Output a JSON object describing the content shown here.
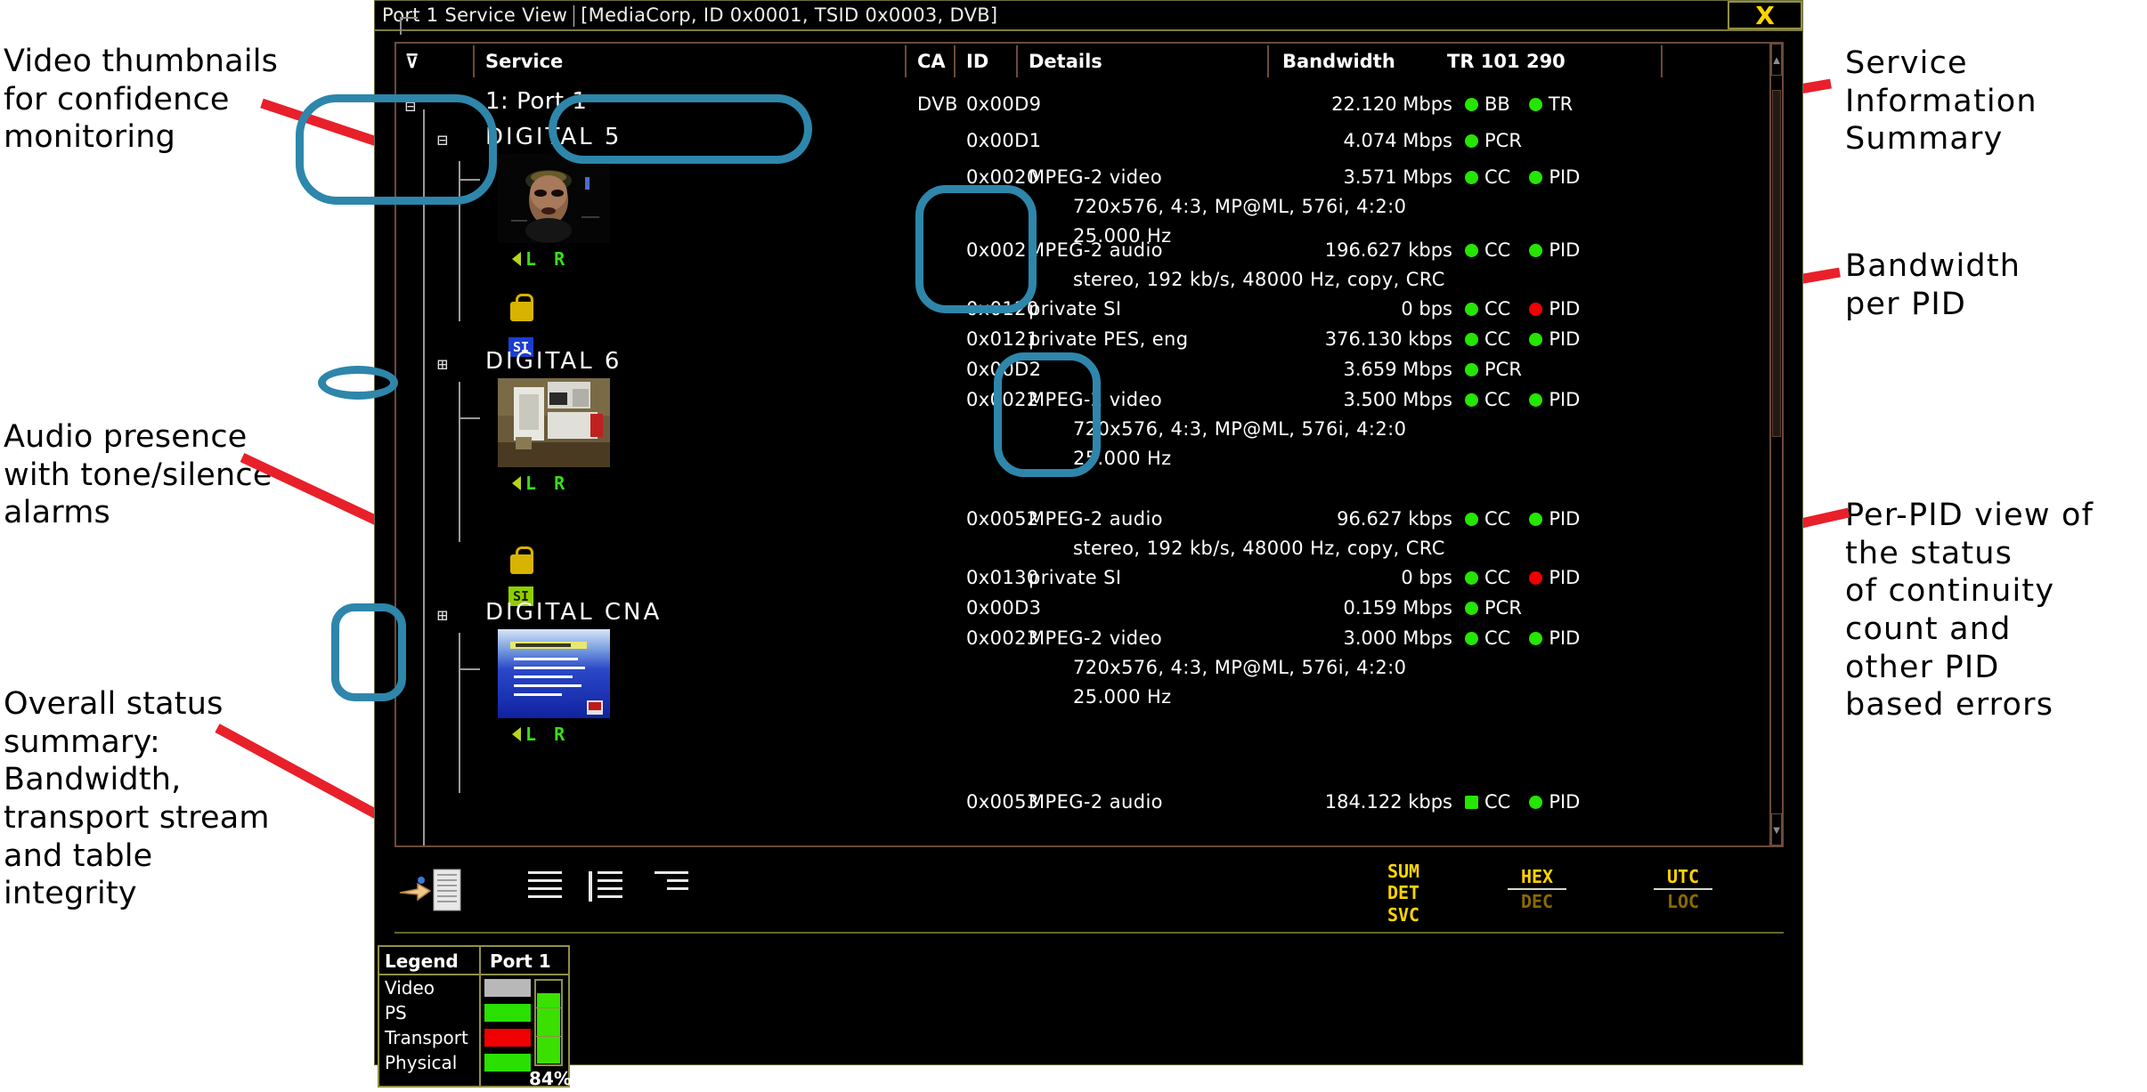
{
  "annotations": [
    {
      "id": "a1",
      "text": "Video thumbnails\nfor confidence\nmonitoring"
    },
    {
      "id": "a2",
      "text": "Audio presence\nwith tone/silence\nalarms"
    },
    {
      "id": "a3",
      "text": "Overall status\nsummary:\nBandwidth,\ntransport stream\nand table\nintegrity"
    },
    {
      "id": "a4",
      "text": "Service\nInformation\nSummary"
    },
    {
      "id": "a5",
      "text": "Bandwidth\nper PID"
    },
    {
      "id": "a6",
      "text": "Per-PID view of\nthe status\nof continuity\ncount and\nother PID\nbased errors"
    }
  ],
  "window": {
    "title": "Port 1 Service View",
    "subtitle": "[MediaCorp, ID 0x0001, TSID 0x0003, DVB]",
    "close_label": "X"
  },
  "table": {
    "headers": {
      "service": "Service",
      "ca": "CA",
      "id": "ID",
      "details": "Details",
      "bandwidth": "Bandwidth",
      "tr": "TR 101 290"
    },
    "root": {
      "service": "1: Port 1",
      "ca": "DVB",
      "id": "0x00D9",
      "bandwidth": "22.120 Mbps",
      "flag1": "BB",
      "flag2": "TR"
    },
    "root_child": {
      "id": "0x00D1",
      "bandwidth": "4.074 Mbps",
      "flag1": "PCR"
    },
    "services": [
      {
        "name": "DIGITAL 5",
        "audio": "L R",
        "rows": [
          {
            "id": "0x0020",
            "detail": "MPEG-2 video",
            "sub": [
              "720x576, 4:3, MP@ML, 576i, 4:2:0",
              "25.000 Hz"
            ],
            "bandwidth": "3.571 Mbps",
            "flags": [
              {
                "label": "CC",
                "color": "green"
              },
              {
                "label": "PID",
                "color": "green"
              }
            ]
          }
        ]
      },
      {
        "name": "DIGITAL 6",
        "audio": "L R",
        "rows": [
          {
            "id": "0x0021",
            "detail": "MPEG-2 audio",
            "sub": [
              "stereo, 192 kb/s, 48000 Hz, copy, CRC"
            ],
            "bandwidth": "196.627 kbps",
            "flags": [
              {
                "label": "CC",
                "color": "green"
              },
              {
                "label": "PID",
                "color": "green"
              }
            ]
          },
          {
            "id": "0x0120",
            "detail": "private SI",
            "sub": [],
            "bandwidth": "0 bps",
            "flags": [
              {
                "label": "CC",
                "color": "green"
              },
              {
                "label": "PID",
                "color": "red"
              }
            ]
          },
          {
            "id": "0x0121",
            "detail": "private PES, eng",
            "sub": [],
            "bandwidth": "376.130 kbps",
            "flags": [
              {
                "label": "CC",
                "color": "green"
              },
              {
                "label": "PID",
                "color": "green"
              }
            ]
          },
          {
            "id": "0x00D2",
            "detail": "",
            "sub": [],
            "bandwidth": "3.659 Mbps",
            "flags": [
              {
                "label": "PCR",
                "color": "green"
              }
            ]
          },
          {
            "id": "0x0022",
            "detail": "MPEG-2 video",
            "sub": [
              "720x576, 4:3, MP@ML, 576i, 4:2:0",
              "25.000 Hz"
            ],
            "bandwidth": "3.500 Mbps",
            "flags": [
              {
                "label": "CC",
                "color": "green"
              },
              {
                "label": "PID",
                "color": "green"
              }
            ]
          }
        ]
      },
      {
        "name": "DIGITAL CNA",
        "audio": "L R",
        "rows": [
          {
            "id": "0x0052",
            "detail": "MPEG-2 audio",
            "sub": [
              "stereo, 192 kb/s, 48000 Hz, copy, CRC"
            ],
            "bandwidth": "96.627 kbps",
            "flags": [
              {
                "label": "CC",
                "color": "green"
              },
              {
                "label": "PID",
                "color": "green"
              }
            ]
          },
          {
            "id": "0x0130",
            "detail": "private SI",
            "sub": [],
            "bandwidth": "0 bps",
            "flags": [
              {
                "label": "CC",
                "color": "green"
              },
              {
                "label": "PID",
                "color": "red"
              }
            ]
          },
          {
            "id": "0x00D3",
            "detail": "",
            "sub": [],
            "bandwidth": "0.159 Mbps",
            "flags": [
              {
                "label": "PCR",
                "color": "green"
              }
            ]
          },
          {
            "id": "0x0023",
            "detail": "MPEG-2 video",
            "sub": [
              "720x576, 4:3, MP@ML, 576i, 4:2:0",
              "25.000 Hz"
            ],
            "bandwidth": "3.000 Mbps",
            "flags": [
              {
                "label": "CC",
                "color": "green"
              },
              {
                "label": "PID",
                "color": "green"
              }
            ]
          }
        ]
      }
    ],
    "last_partial_row": {
      "id": "0x0053",
      "detail": "MPEG-2 audio",
      "bandwidth": "184.122 kbps",
      "flags": [
        {
          "label": "CC",
          "color": "green"
        },
        {
          "label": "PID",
          "color": "green"
        }
      ]
    }
  },
  "toolbar": {
    "sum_det_svc": {
      "line1": "SUM",
      "line2": "DET",
      "line3": "SVC"
    },
    "hex_dec": {
      "on": "HEX",
      "off": "DEC"
    },
    "utc_loc": {
      "on": "UTC",
      "off": "LOC"
    }
  },
  "legend": {
    "col1": "Legend",
    "col2": "Port 1",
    "rows": [
      {
        "label": "Video",
        "color": "#b8b8b8"
      },
      {
        "label": "PS",
        "color": "#2ae000"
      },
      {
        "label": "Transport",
        "color": "#f00000"
      },
      {
        "label": "Physical",
        "color": "#2ae000"
      }
    ],
    "gauge_percent": "84%",
    "gauge_value": 84
  },
  "colors": {
    "accent": "#2e86ab",
    "arrow": "#e8202a",
    "ok": "#25e600",
    "error": "#f00000",
    "amber": "#ffd400",
    "frame": "#6b4a3c",
    "chrome": "#8f8f46"
  }
}
